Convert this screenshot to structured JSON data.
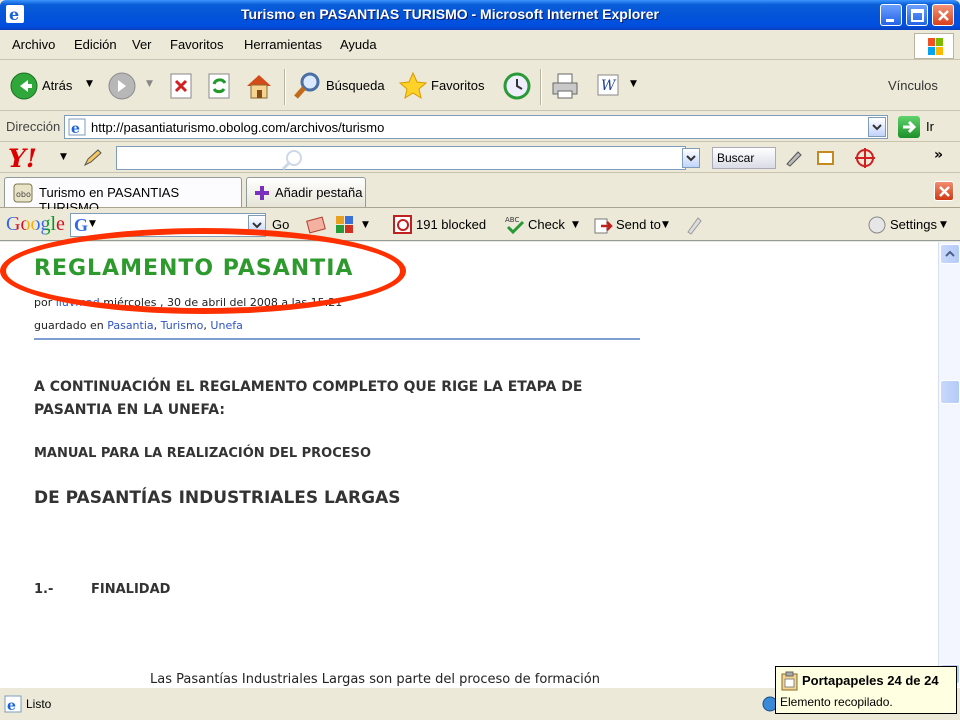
{
  "window": {
    "title": "Turismo en PASANTIAS TURISMO - Microsoft Internet Explorer"
  },
  "menu": {
    "items": [
      "Archivo",
      "Edición",
      "Ver",
      "Favoritos",
      "Herramientas",
      "Ayuda"
    ]
  },
  "toolbar": {
    "back_label": "Atrás",
    "search_label": "Búsqueda",
    "favorites_label": "Favoritos",
    "links_label": "Vínculos"
  },
  "address": {
    "label": "Dirección",
    "url": "http://pasantiaturismo.obolog.com/archivos/turismo",
    "go_label": "Ir"
  },
  "yahoo": {
    "logo": "Y!",
    "search_button": "Buscar"
  },
  "tabs": {
    "active_label": "Turismo en PASANTIAS TURISMO",
    "new_tab_label": "Añadir pestaña"
  },
  "google": {
    "logo": "Google",
    "go_label": "Go",
    "blocked_label": "191 blocked",
    "check_label": "Check",
    "sendto_label": "Send to",
    "settings_label": "Settings"
  },
  "post": {
    "title": "REGLAMENTO PASANTIA",
    "meta_prefix": "por",
    "meta_author": "iluvmad",
    "meta_date": "miércoles , 30 de abril del 2008 a las 15:21",
    "saved_in": "guardado en",
    "categories": [
      "Pasantia",
      "Turismo",
      "Unefa"
    ],
    "paragraph1": "A CONTINUACIÓN EL REGLAMENTO COMPLETO QUE RIGE LA ETAPA DE PASANTIA EN LA UNEFA:",
    "paragraph2": "MANUAL PARA LA REALIZACIÓN DEL PROCESO",
    "paragraph3": "DE PASANTÍAS INDUSTRIALES LARGAS",
    "section_number": "1.-",
    "section_title": "FINALIDAD",
    "paragraph5": "Las Pasantías Industriales Largas son parte del proceso de formación"
  },
  "status": {
    "text": "Listo"
  },
  "clipboard": {
    "title": "Portapapeles 24 de 24",
    "subtitle": "Elemento recopilado."
  },
  "colors": {
    "title_green": "#2d9a2d",
    "highlight_red": "#ff3000",
    "titlebar_blue": "#0453d8"
  }
}
